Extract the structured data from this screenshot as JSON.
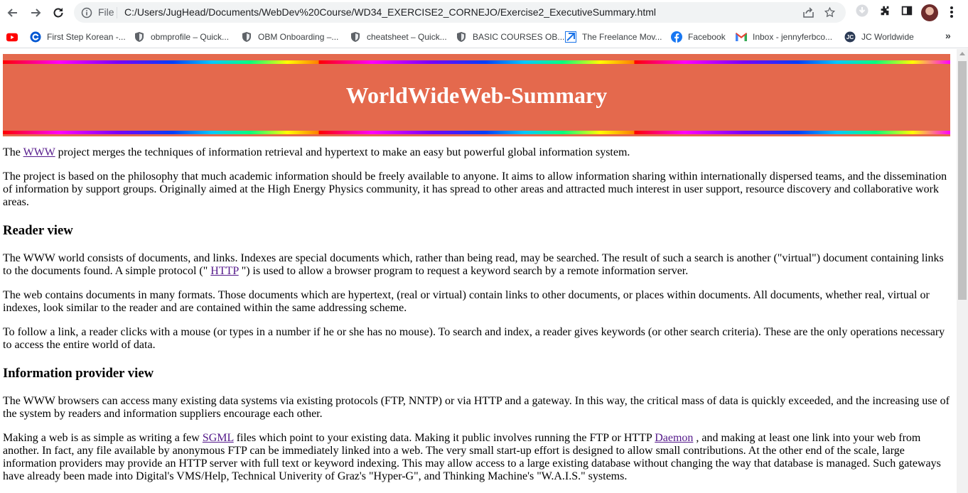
{
  "browser": {
    "scheme_label": "File",
    "url": "C:/Users/JugHead/Documents/WebDev%20Course/WD34_EXERCISE2_CORNEJO/Exercise2_ExecutiveSummary.html",
    "bookmarks": [
      {
        "label": "",
        "icon": "youtube-icon"
      },
      {
        "label": "First Step Korean -...",
        "icon": "coursera-icon"
      },
      {
        "label": "obmprofile – Quick...",
        "icon": "shield-icon"
      },
      {
        "label": "OBM Onboarding –...",
        "icon": "shield-icon"
      },
      {
        "label": "cheatsheet – Quick...",
        "icon": "shield-icon"
      },
      {
        "label": "BASIC COURSES OB...",
        "icon": "shield-icon"
      },
      {
        "label": "The Freelance Mov...",
        "icon": "freelance-icon"
      },
      {
        "label": "Facebook",
        "icon": "facebook-icon"
      },
      {
        "label": "Inbox - jennyferbco...",
        "icon": "gmail-icon"
      },
      {
        "label": "JC Worldwide",
        "icon": "jc-icon"
      }
    ],
    "more_label": "»"
  },
  "page": {
    "title": "WorldWideWeb-Summary",
    "intro": {
      "before": "The ",
      "link": "WWW",
      "after": " project merges the techniques of information retrieval and hypertext to make an easy but powerful global information system."
    },
    "p2": "The project is based on the philosophy that much academic information should be freely available to anyone. It aims to allow information sharing within internationally dispersed teams, and the dissemination of information by support groups. Originally aimed at the High Energy Physics community, it has spread to other areas and attracted much interest in user support, resource discovery and collaborative work areas.",
    "reader_heading": "Reader view",
    "reader_p1": {
      "before": "The WWW world consists of documents, and links. Indexes are special documents which, rather than being read, may be searched. The result of such a search is another (\"virtual\") document containing links to the documents found. A simple protocol (\" ",
      "link": "HTTP",
      "after": " \") is used to allow a browser program to request a keyword search by a remote information server."
    },
    "reader_p2": "The web contains documents in many formats. Those documents which are hypertext, (real or virtual) contain links to other documents, or places within documents. All documents, whether real, virtual or indexes, look similar to the reader and are contained within the same addressing scheme.",
    "reader_p3": "To follow a link, a reader clicks with a mouse (or types in a number if he or she has no mouse). To search and index, a reader gives keywords (or other search criteria). These are the only operations necessary to access the entire world of data.",
    "provider_heading": "Information provider view",
    "provider_p1": "The WWW browsers can access many existing data systems via existing protocols (FTP, NNTP) or via HTTP and a gateway. In this way, the critical mass of data is quickly exceeded, and the increasing use of the system by readers and information suppliers encourage each other.",
    "provider_p2": {
      "before": "Making a web is as simple as writing a few ",
      "link1": "SGML",
      "middle": " files which point to your existing data. Making it public involves running the FTP or HTTP ",
      "link2": "Daemon",
      "after": " , and making at least one link into your web from another. In fact, any file available by anonymous FTP can be immediately linked into a web. The very small start-up effort is designed to allow small contributions. At the other end of the scale, large information providers may provide an HTTP server with full text or keyword indexing. This may allow access to a large existing database without changing the way that database is managed. Such gateways have already been made into Digital's VMS/Help, Technical Univerity of Graz's \"Hyper-G\", and Thinking Machine's \"W.A.I.S.\" systems."
    },
    "colors": {
      "header_bg": "#e4694d",
      "title_text": "#ffffff",
      "link": "#551a8b"
    }
  }
}
